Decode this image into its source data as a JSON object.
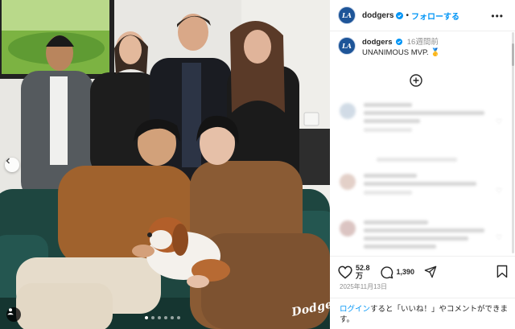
{
  "post": {
    "username": "dodgers",
    "separator": "•",
    "follow_label": "フォローする",
    "more_label": "•••",
    "avatar_text": "LA",
    "caption_time": "16週間前",
    "caption_text": "UNANIMOUS MVP. 🥇",
    "likes_value": "52.8",
    "likes_unit": "万",
    "comments_count": "1,390",
    "date": "2025年11月13日",
    "login_link": "ログイン",
    "login_rest": "すると「いいね！」やコメントができます。",
    "photo_watermark": "Dodgers",
    "carousel": {
      "count": 6,
      "active": 0
    }
  },
  "colors": {
    "link_blue": "#0095f6",
    "dodgers_blue": "#1e5598",
    "muted_text": "#8e8e8e"
  },
  "icons": [
    "verified-icon",
    "more-icon",
    "add-comment-icon",
    "heart-icon",
    "comment-icon",
    "share-icon",
    "bookmark-icon",
    "prev-arrow-icon",
    "user-tag-icon"
  ]
}
